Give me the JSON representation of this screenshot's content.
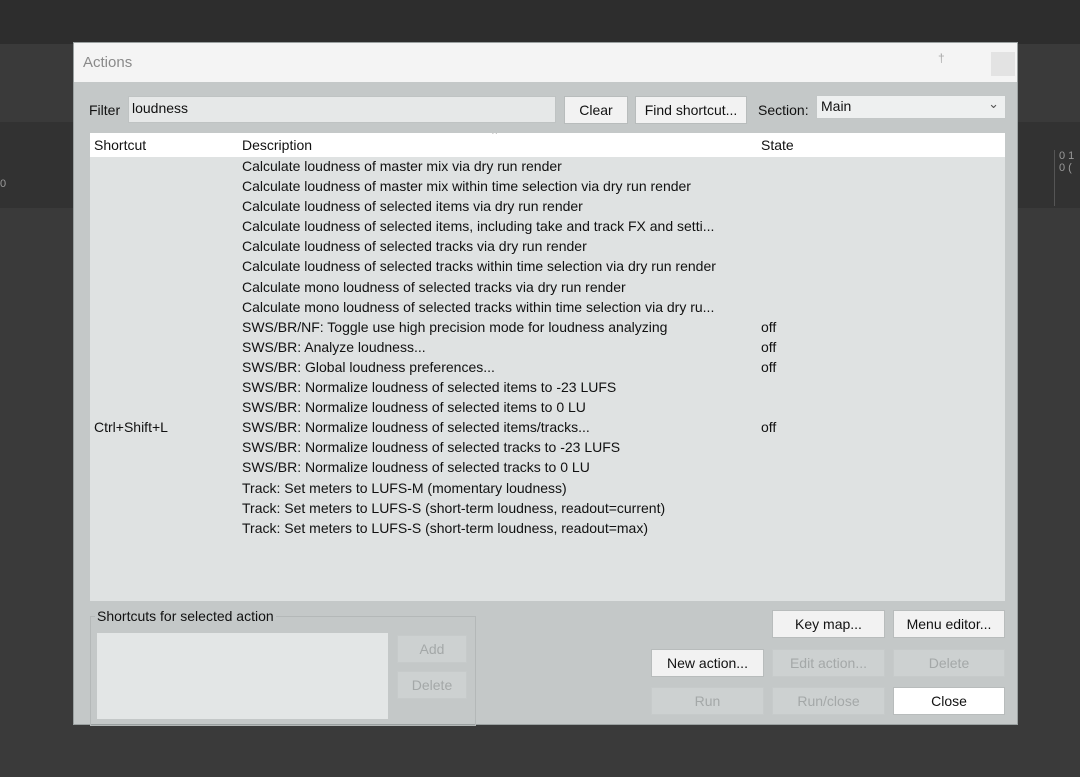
{
  "dialog": {
    "title": "Actions",
    "pin_glyph": "†"
  },
  "filter": {
    "label": "Filter",
    "value": "loudness"
  },
  "buttons": {
    "clear": "Clear",
    "find_shortcut": "Find shortcut...",
    "key_map": "Key map...",
    "menu_editor": "Menu editor...",
    "new_action": "New action...",
    "edit_action": "Edit action...",
    "delete": "Delete",
    "run": "Run",
    "run_close": "Run/close",
    "close": "Close",
    "add": "Add",
    "shortcut_delete": "Delete"
  },
  "section": {
    "label": "Section:",
    "value": "Main"
  },
  "table": {
    "headers": {
      "shortcut": "Shortcut",
      "description": "Description",
      "state": "State"
    },
    "rows": [
      {
        "shortcut": "",
        "description": "Calculate loudness of master mix via dry run render",
        "state": ""
      },
      {
        "shortcut": "",
        "description": "Calculate loudness of master mix within time selection via dry run render",
        "state": ""
      },
      {
        "shortcut": "",
        "description": "Calculate loudness of selected items via dry run render",
        "state": ""
      },
      {
        "shortcut": "",
        "description": "Calculate loudness of selected items, including take and track FX and setti...",
        "state": ""
      },
      {
        "shortcut": "",
        "description": "Calculate loudness of selected tracks via dry run render",
        "state": ""
      },
      {
        "shortcut": "",
        "description": "Calculate loudness of selected tracks within time selection via dry run render",
        "state": ""
      },
      {
        "shortcut": "",
        "description": "Calculate mono loudness of selected tracks via dry run render",
        "state": ""
      },
      {
        "shortcut": "",
        "description": "Calculate mono loudness of selected tracks within time selection via dry ru...",
        "state": ""
      },
      {
        "shortcut": "",
        "description": "SWS/BR/NF: Toggle use high precision mode for loudness analyzing",
        "state": "off"
      },
      {
        "shortcut": "",
        "description": "SWS/BR: Analyze loudness...",
        "state": "off"
      },
      {
        "shortcut": "",
        "description": "SWS/BR: Global loudness preferences...",
        "state": "off"
      },
      {
        "shortcut": "",
        "description": "SWS/BR: Normalize loudness of selected items to -23 LUFS",
        "state": ""
      },
      {
        "shortcut": "",
        "description": "SWS/BR: Normalize loudness of selected items to 0 LU",
        "state": ""
      },
      {
        "shortcut": "Ctrl+Shift+L",
        "description": "SWS/BR: Normalize loudness of selected items/tracks...",
        "state": "off"
      },
      {
        "shortcut": "",
        "description": "SWS/BR: Normalize loudness of selected tracks to -23 LUFS",
        "state": ""
      },
      {
        "shortcut": "",
        "description": "SWS/BR: Normalize loudness of selected tracks to 0 LU",
        "state": ""
      },
      {
        "shortcut": "",
        "description": "Track: Set meters to LUFS-M (momentary loudness)",
        "state": ""
      },
      {
        "shortcut": "",
        "description": "Track: Set meters to LUFS-S (short-term loudness, readout=current)",
        "state": ""
      },
      {
        "shortcut": "",
        "description": "Track: Set meters to LUFS-S (short-term loudness, readout=max)",
        "state": ""
      }
    ]
  },
  "shortcuts_group": {
    "title": "Shortcuts for selected action"
  },
  "background": {
    "partial_text": "0 1\n0 (",
    "left_edge": "0"
  },
  "icons": {
    "section_dropdown": "chevron-down-icon",
    "sort": "sort-ascending-icon"
  }
}
